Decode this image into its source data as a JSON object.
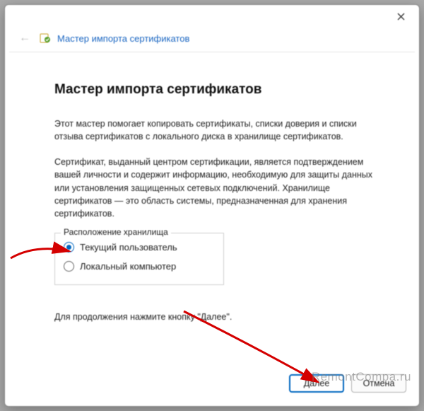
{
  "header": {
    "title": "Мастер импорта сертификатов"
  },
  "page": {
    "heading": "Мастер импорта сертификатов",
    "intro": "Этот мастер помогает копировать сертификаты, списки доверия и списки отзыва сертификатов с локального диска в хранилище сертификатов.",
    "explain": "Сертификат, выданный центром сертификации, является подтверждением вашей личности и содержит информацию, необходимую для защиты данных или установления защищенных сетевых подключений. Хранилище сертификатов — это область системы, предназначенная для хранения сертификатов.",
    "store_legend": "Расположение хранилища",
    "option_current_user": "Текущий пользователь",
    "option_local_machine": "Локальный компьютер",
    "continue_hint": "Для продолжения нажмите кнопку \"Далее\"."
  },
  "buttons": {
    "next": "Далее",
    "cancel": "Отмена"
  },
  "watermark": "RemontCompa.ru",
  "selected": "current_user"
}
